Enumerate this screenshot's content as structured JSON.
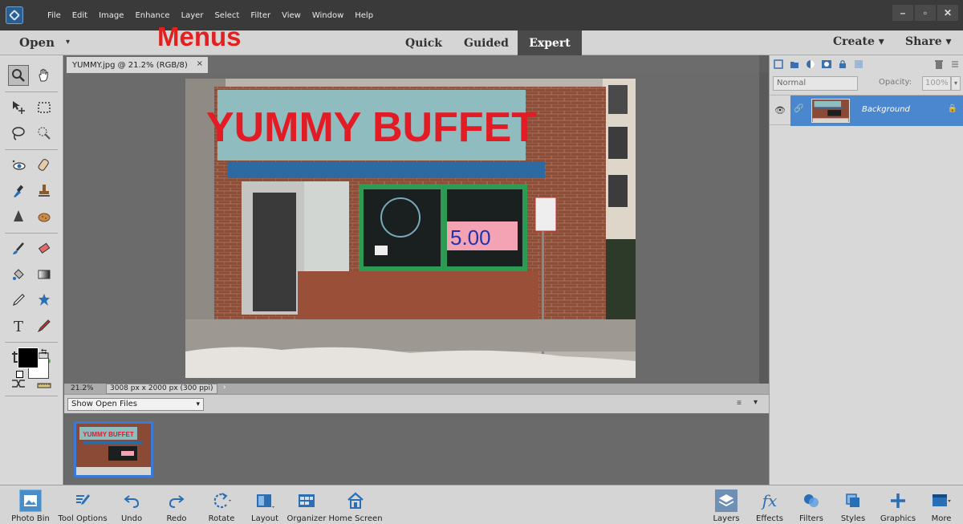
{
  "menubar": {
    "items": [
      "File",
      "Edit",
      "Image",
      "Enhance",
      "Layer",
      "Select",
      "Filter",
      "View",
      "Window",
      "Help"
    ]
  },
  "window_controls": {
    "minimize": "–",
    "restore": "▫",
    "close": "✕"
  },
  "modebar": {
    "open_label": "Open",
    "open_caret": "▾",
    "annotation": "Menus",
    "tabs": [
      {
        "label": "Quick",
        "active": false
      },
      {
        "label": "Guided",
        "active": false
      },
      {
        "label": "Expert",
        "active": true
      }
    ],
    "create_label": "Create  ▾",
    "share_label": "Share  ▾"
  },
  "document": {
    "tab_title": "YUMMY.jpg @ 21.2% (RGB/8)",
    "tab_close": "×",
    "image_text": "YUMMY BUFFET",
    "price_sign": "5.00"
  },
  "statusbar": {
    "zoom": "21.2%",
    "doc_size": "3008 px x 2000 px (300 ppi)",
    "arrow": "›"
  },
  "photobin": {
    "selector_value": "Show Open Files",
    "selector_caret": "▾",
    "menu_icon": "≡",
    "collapse_icon": "▾",
    "thumb_text": "YUMMY BUFFET"
  },
  "layers": {
    "blend_mode": "Normal",
    "opacity_label": "Opacity:",
    "opacity_value": "100%",
    "layer_name": "Background",
    "eye": "👁",
    "link": "🔗",
    "lock": "🔒"
  },
  "taskbar": {
    "left": [
      {
        "label": "Photo Bin",
        "icon": "photo-bin-icon"
      },
      {
        "label": "Tool Options",
        "icon": "tool-options-icon"
      },
      {
        "label": "Undo",
        "icon": "undo-icon"
      },
      {
        "label": "Redo",
        "icon": "redo-icon"
      },
      {
        "label": "Rotate",
        "icon": "rotate-icon"
      },
      {
        "label": "Layout",
        "icon": "layout-icon"
      },
      {
        "label": "Organizer",
        "icon": "organizer-icon"
      },
      {
        "label": "Home Screen",
        "icon": "home-icon"
      }
    ],
    "right": [
      {
        "label": "Layers",
        "icon": "layers-icon"
      },
      {
        "label": "Effects",
        "icon": "effects-icon"
      },
      {
        "label": "Filters",
        "icon": "filters-icon"
      },
      {
        "label": "Styles",
        "icon": "styles-icon"
      },
      {
        "label": "Graphics",
        "icon": "graphics-icon"
      },
      {
        "label": "More",
        "icon": "more-icon"
      }
    ]
  },
  "colors": {
    "accent": "#4a87cf",
    "annotation": "#e32020",
    "foreground": "#000000",
    "background": "#ffffff"
  }
}
